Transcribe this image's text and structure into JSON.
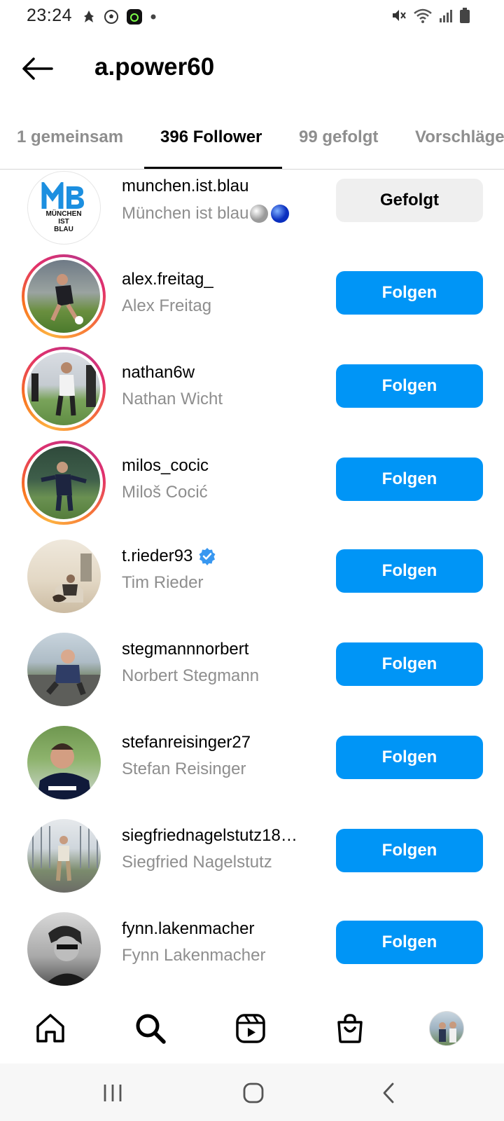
{
  "status_bar": {
    "time": "23:24"
  },
  "header": {
    "title": "a.power60"
  },
  "tabs": [
    {
      "label": "1 gemeinsam"
    },
    {
      "label": "396 Follower"
    },
    {
      "label": "99 gefolgt"
    },
    {
      "label": "Vorschläge"
    }
  ],
  "accounts": [
    {
      "username": "munchen.ist.blau",
      "fullname": "München ist blau",
      "button": "Gefolgt",
      "verified": false,
      "story_ring": false,
      "avatar_text": [
        "MB",
        "MÜNCHEN",
        "IST",
        "BLAU"
      ]
    },
    {
      "username": "alex.freitag_",
      "fullname": "Alex Freitag",
      "button": "Folgen",
      "verified": false,
      "story_ring": true
    },
    {
      "username": "nathan6w",
      "fullname": "Nathan Wicht",
      "button": "Folgen",
      "verified": false,
      "story_ring": true
    },
    {
      "username": "milos_cocic",
      "fullname": "Miloš Cocić",
      "button": "Folgen",
      "verified": false,
      "story_ring": true
    },
    {
      "username": "t.rieder93",
      "fullname": "Tim Rieder",
      "button": "Folgen",
      "verified": true,
      "story_ring": false
    },
    {
      "username": "stegmannnorbert",
      "fullname": "Norbert Stegmann",
      "button": "Folgen",
      "verified": false,
      "story_ring": false
    },
    {
      "username": "stefanreisinger27",
      "fullname": "Stefan Reisinger",
      "button": "Folgen",
      "verified": false,
      "story_ring": false
    },
    {
      "username": "siegfriednagelstutz18…",
      "fullname": "Siegfried Nagelstutz",
      "button": "Folgen",
      "verified": false,
      "story_ring": false
    },
    {
      "username": "fynn.lakenmacher",
      "fullname": "Fynn Lakenmacher",
      "button": "Folgen",
      "verified": false,
      "story_ring": false
    }
  ],
  "bottom_nav": [
    "home-icon",
    "search-icon",
    "reels-icon",
    "shop-icon",
    "profile-avatar"
  ],
  "colors": {
    "follow_button": "#0095f6",
    "followed_button": "#efefef",
    "secondary_text": "#8e8e8e"
  }
}
